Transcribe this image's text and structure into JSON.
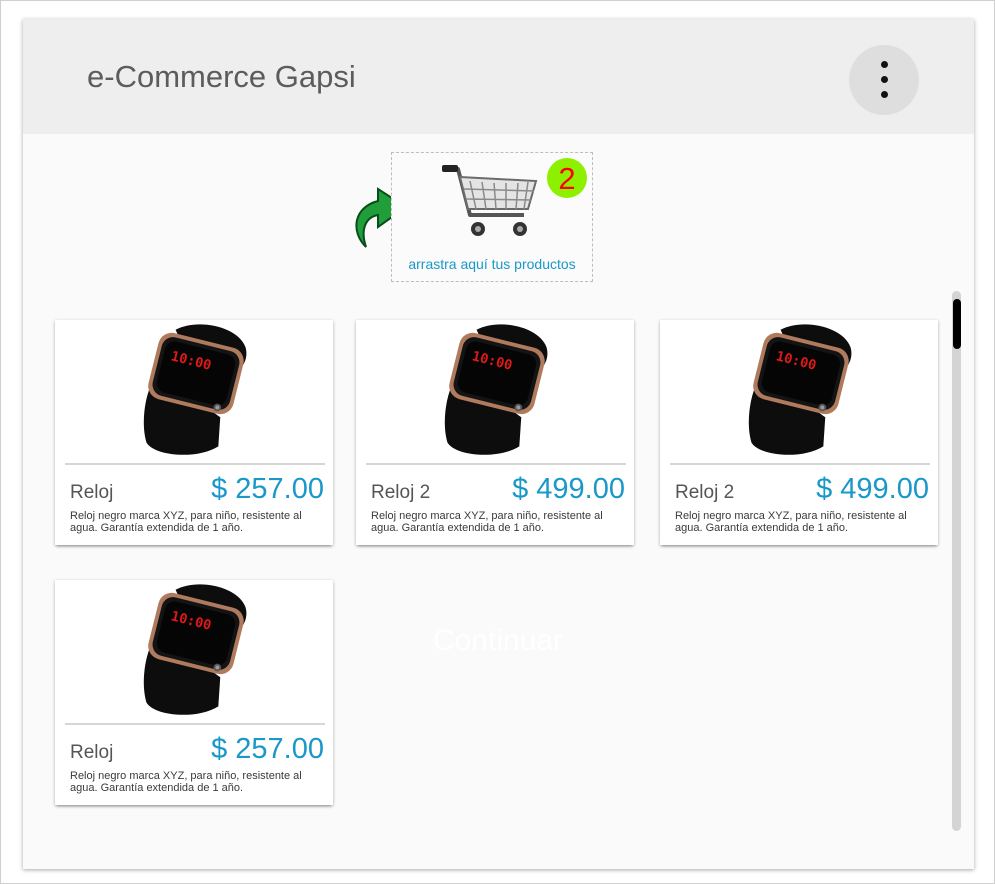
{
  "header": {
    "title": "e-Commerce Gapsi",
    "menu_icon": "more-vert-icon"
  },
  "cart": {
    "badge_count": "2",
    "dropzone_label": "arrastra aquí tus productos",
    "icon": "shopping-cart-icon",
    "arrow_icon": "curved-arrow-icon"
  },
  "products": [
    {
      "name": "Reloj",
      "price": "$ 257.00",
      "description": "Reloj negro marca XYZ, para niño, resistente al agua. Garantía extendida de 1 año."
    },
    {
      "name": "Reloj 2",
      "price": "$ 499.00",
      "description": "Reloj negro marca XYZ, para niño, resistente al agua. Garantía extendida de 1 año."
    },
    {
      "name": "Reloj 2",
      "price": "$ 499.00",
      "description": "Reloj negro marca XYZ, para niño, resistente al agua. Garantía extendida de 1 año."
    },
    {
      "name": "Reloj",
      "price": "$ 257.00",
      "description": "Reloj negro marca XYZ, para niño, resistente al agua. Garantía extendida de 1 año."
    }
  ],
  "continue_label": "Continuar",
  "colors": {
    "accent": "#1a98c9",
    "badge_bg": "#8df000",
    "badge_text": "#ff0000",
    "header_bg": "#eeeeee",
    "arrow_green": "#1f9e3a"
  }
}
